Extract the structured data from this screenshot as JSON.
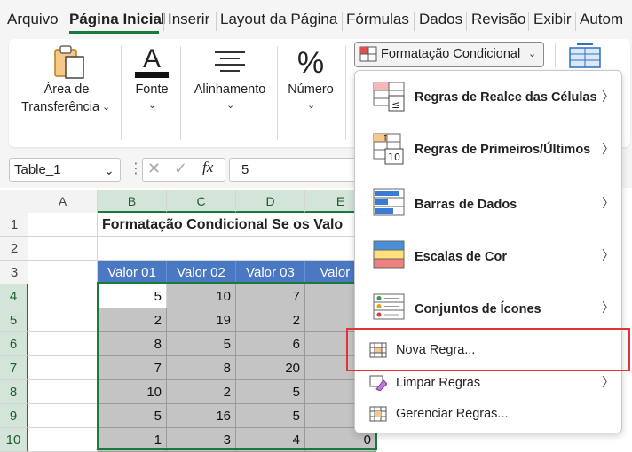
{
  "tabs": [
    "Arquivo",
    "Página Inicial",
    "Inserir",
    "Layout da Página",
    "Fórmulas",
    "Dados",
    "Revisão",
    "Exibir",
    "Autom"
  ],
  "ribbon": {
    "clipboard_line1": "Área de",
    "clipboard_line2": "Transferência",
    "font": "Fonte",
    "alignment": "Alinhamento",
    "number": "Número",
    "conditional_formatting": "Formatação Condicional"
  },
  "formula_bar": {
    "name_box": "Table_1",
    "fx": "fx",
    "value": "5"
  },
  "columns": [
    "A",
    "B",
    "C",
    "D",
    "E"
  ],
  "rows": [
    "1",
    "2",
    "3",
    "4",
    "5",
    "6",
    "7",
    "8",
    "9",
    "10"
  ],
  "sheet": {
    "title": "Formatação Condicional Se os Valo",
    "headers": [
      "Valor 01",
      "Valor 02",
      "Valor 03",
      "Valor 0"
    ],
    "data": [
      [
        "5",
        "10",
        "7"
      ],
      [
        "2",
        "19",
        "2"
      ],
      [
        "8",
        "5",
        "6"
      ],
      [
        "7",
        "8",
        "20"
      ],
      [
        "10",
        "2",
        "5"
      ],
      [
        "5",
        "16",
        "5"
      ],
      [
        "1",
        "3",
        "4",
        "0"
      ]
    ]
  },
  "menu": {
    "items": [
      {
        "label": "Regras de Realce das Células",
        "bold": true,
        "submenu": true
      },
      {
        "label": "Regras de Primeiros/Últimos",
        "bold": true,
        "submenu": true
      },
      {
        "label": "Barras de Dados",
        "bold": true,
        "submenu": true
      },
      {
        "label": "Escalas de Cor",
        "bold": true,
        "submenu": true
      },
      {
        "label": "Conjuntos de Ícones",
        "bold": true,
        "submenu": true
      },
      {
        "label": "Nova Regra...",
        "bold": false,
        "submenu": false
      },
      {
        "label": "Limpar Regras",
        "bold": false,
        "submenu": true
      },
      {
        "label": "Gerenciar Regras...",
        "bold": false,
        "submenu": false
      }
    ]
  },
  "colors": {
    "accent_green": "#1a7a3a",
    "header_blue": "#4a78c2",
    "highlight_red": "#e0343c"
  }
}
